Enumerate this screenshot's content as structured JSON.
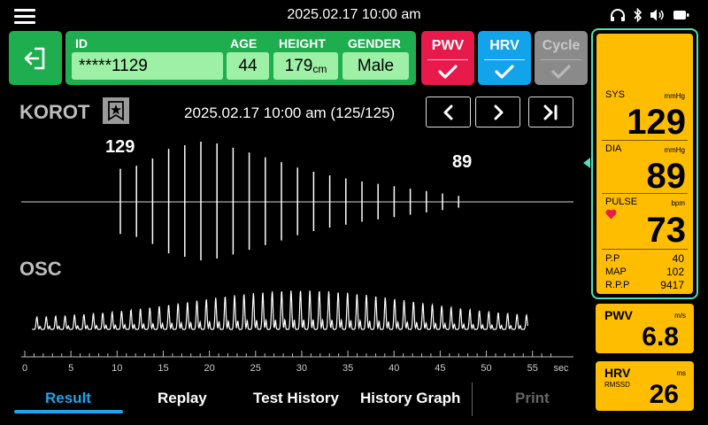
{
  "status": {
    "datetime": "2025.02.17  10:00 am"
  },
  "patient": {
    "id_label": "ID",
    "id_value": "*****1129",
    "age_label": "AGE",
    "age_value": "44",
    "height_label": "HEIGHT",
    "height_value": "179",
    "height_unit": "cm",
    "gender_label": "GENDER",
    "gender_value": "Male"
  },
  "modes": [
    {
      "label": "PWV",
      "color": "#e8194b",
      "enabled": true
    },
    {
      "label": "HRV",
      "color": "#12a3ea",
      "enabled": true
    },
    {
      "label": "Cycle",
      "color": "#8a8a8a",
      "enabled": false
    }
  ],
  "korot": {
    "title": "KOROT",
    "timestamp": "2025.02.17 10:00 am (125/125)",
    "sys_marker": "129",
    "dia_marker": "89",
    "spike_amplitudes": [
      0.55,
      0.6,
      0.72,
      0.88,
      0.94,
      1.0,
      0.97,
      0.9,
      0.82,
      0.74,
      0.66,
      0.57,
      0.5,
      0.44,
      0.39,
      0.34,
      0.3,
      0.26,
      0.22,
      0.18,
      0.14,
      0.1
    ]
  },
  "osc": {
    "title": "OSC",
    "x_ticks": [
      "0",
      "5",
      "10",
      "15",
      "20",
      "25",
      "30",
      "35",
      "40",
      "45",
      "50",
      "55"
    ],
    "x_unit": "sec",
    "x_max": 58
  },
  "tabs": {
    "result": "Result",
    "replay": "Replay",
    "test_history": "Test History",
    "history_graph": "History Graph",
    "print": "Print"
  },
  "vitals": {
    "sys_label": "SYS",
    "sys_unit": "mmHg",
    "sys_value": "129",
    "dia_label": "DIA",
    "dia_unit": "mmHg",
    "dia_value": "89",
    "pulse_label": "PULSE",
    "pulse_unit": "bpm",
    "pulse_value": "73",
    "pp_label": "P.P",
    "pp_value": "40",
    "map_label": "MAP",
    "map_value": "102",
    "rpp_label": "R.P.P",
    "rpp_value": "9417"
  },
  "pwv": {
    "label": "PWV",
    "unit": "m/s",
    "value": "6.8"
  },
  "hrv": {
    "label": "HRV",
    "sub": "RMSSD",
    "unit": "ms",
    "value": "26"
  },
  "colors": {
    "accent": "#ffbd00",
    "green": "#1fae4f",
    "highlight": "#4be2b8",
    "tab_active": "#1ea4ee"
  }
}
